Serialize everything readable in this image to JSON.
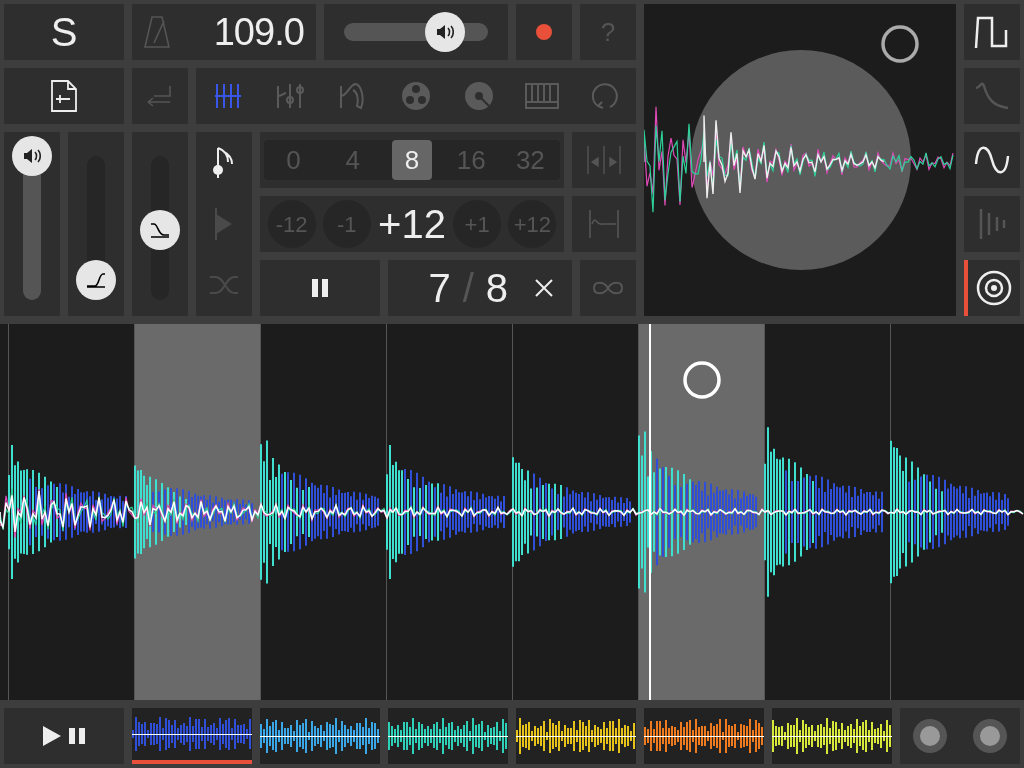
{
  "logo": {
    "text": "S"
  },
  "tempo": {
    "value": "109.0"
  },
  "master_volume": {
    "level": 0.78
  },
  "help": {
    "label": "?"
  },
  "tools": [
    {
      "kind": "slices",
      "selected": true
    },
    {
      "kind": "mixer",
      "selected": false
    },
    {
      "kind": "horn",
      "selected": false
    },
    {
      "kind": "reel",
      "selected": false
    },
    {
      "kind": "disc",
      "selected": false
    },
    {
      "kind": "keyboard",
      "selected": false
    },
    {
      "kind": "loop",
      "selected": false
    }
  ],
  "sliders": [
    {
      "kind": "volume",
      "level": 1
    },
    {
      "kind": "attack",
      "level": 0
    },
    {
      "kind": "release",
      "level": 0.4
    }
  ],
  "modes": [
    {
      "kind": "note",
      "selected": true
    },
    {
      "kind": "play",
      "selected": false
    },
    {
      "kind": "shuffle",
      "selected": false
    }
  ],
  "steps": [
    {
      "label": "0",
      "selected": false
    },
    {
      "label": "4",
      "selected": false
    },
    {
      "label": "8",
      "selected": true
    },
    {
      "label": "16",
      "selected": false
    },
    {
      "label": "32",
      "selected": false
    }
  ],
  "pitch": [
    {
      "kind": "button",
      "label": "-12"
    },
    {
      "kind": "button",
      "label": "-1"
    },
    {
      "kind": "display",
      "label": "+12"
    },
    {
      "kind": "button",
      "label": "+1"
    },
    {
      "kind": "button",
      "label": "+12"
    }
  ],
  "loop_counter": {
    "current": "7",
    "separator": "/",
    "total": "8"
  },
  "waveforms": [
    {
      "kind": "square",
      "selected": false,
      "disabled": false
    },
    {
      "kind": "decay",
      "selected": false,
      "disabled": true
    },
    {
      "kind": "sine",
      "selected": false,
      "disabled": false
    },
    {
      "kind": "bars",
      "selected": false,
      "disabled": true
    },
    {
      "kind": "target",
      "selected": true,
      "disabled": false
    }
  ],
  "slices": [
    {
      "selected": false
    },
    {
      "selected": true
    },
    {
      "selected": false
    },
    {
      "selected": false
    },
    {
      "selected": false
    },
    {
      "selected": true
    },
    {
      "selected": false
    },
    {
      "selected": false
    }
  ],
  "clips": [
    {
      "selected": true,
      "color": "#2f4fd8"
    },
    {
      "selected": false,
      "color": "#3aa8e8"
    },
    {
      "selected": false,
      "color": "#2ed1b8"
    },
    {
      "selected": false,
      "color": "#e6c21a"
    },
    {
      "selected": false,
      "color": "#f07a1e"
    },
    {
      "selected": false,
      "color": "#d8e83a"
    }
  ]
}
